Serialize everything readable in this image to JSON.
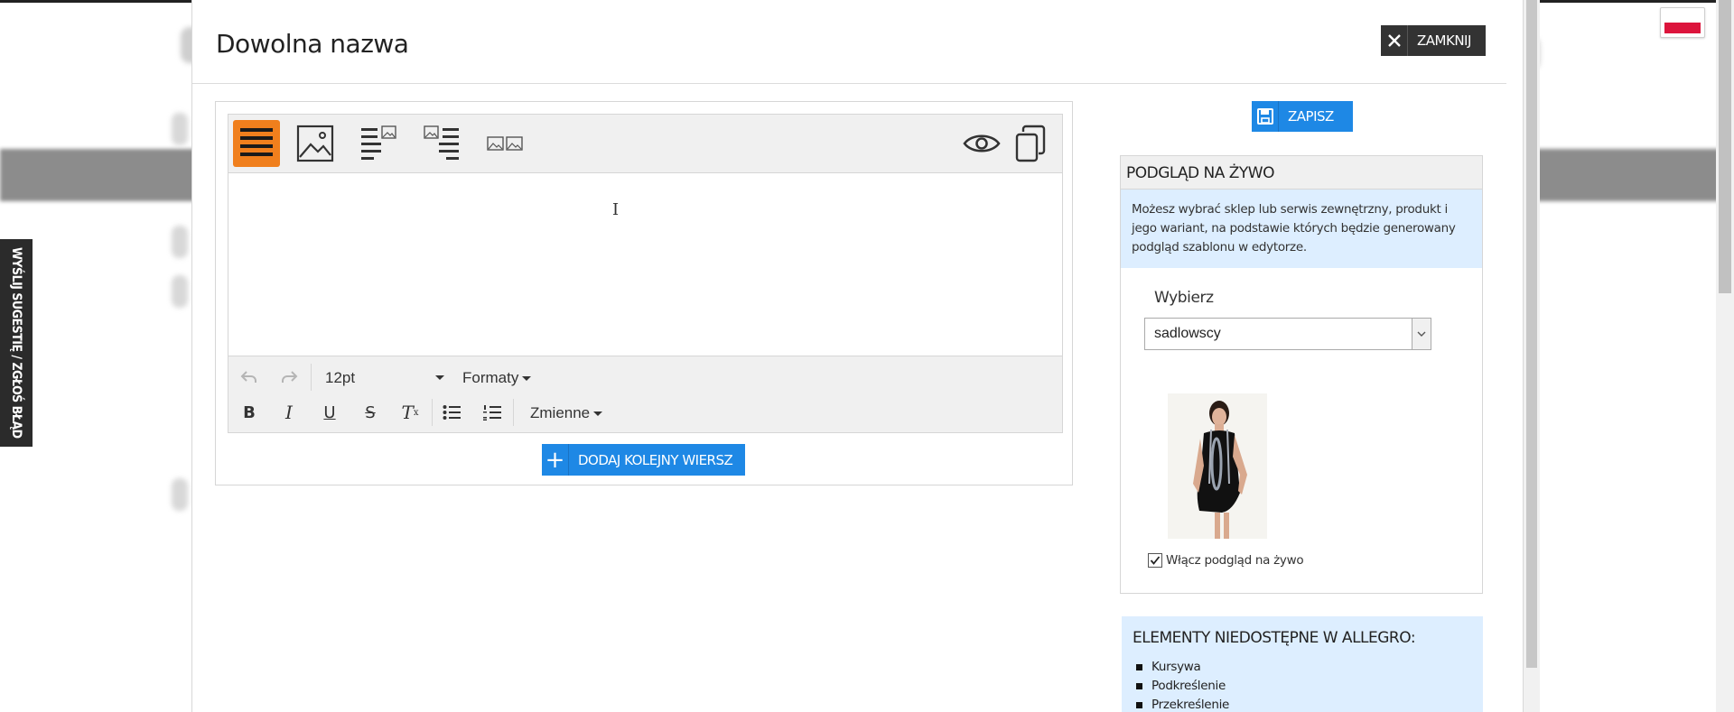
{
  "side_tab": {
    "label": "WYŚLIJ SUGESTIĘ / ZGŁOŚ BŁĄD"
  },
  "language": {
    "flag": "pl-flag",
    "colors": [
      "#ffffff",
      "#dc143c"
    ]
  },
  "modal": {
    "title": "Dowolna nazwa",
    "close_label": "ZAMKNIJ"
  },
  "editor": {
    "layout_tools": [
      {
        "name": "text-only-layout",
        "active": true
      },
      {
        "name": "image-only-layout",
        "active": false
      },
      {
        "name": "text-left-image-right-layout",
        "active": false
      },
      {
        "name": "image-left-text-right-layout",
        "active": false
      },
      {
        "name": "two-images-layout",
        "active": false
      }
    ],
    "preview_icon": "eye-icon",
    "copy_icon": "copy-icon",
    "font_size": "12pt",
    "formats_label": "Formaty",
    "variables_label": "Zmienne",
    "add_row_label": "DODAJ KOLEJNY WIERSZ",
    "accent_color": "#f07f1d"
  },
  "sidebar": {
    "save_label": "ZAPISZ",
    "preview_title": "PODGLĄD NA ŻYWO",
    "preview_info": "Możesz wybrać sklep lub serwis zewnętrzny, produkt i jego wariant, na podstawie których będzie generowany podgląd szablonu w edytorze.",
    "select_label": "Wybierz",
    "select_value": "sadlowscy",
    "live_preview_label": "Włącz podgląd na żywo",
    "live_preview_checked": true,
    "unavailable_title": "ELEMENTY NIEDOSTĘPNE W ALLEGRO:",
    "unavailable_items": [
      "Kursywa",
      "Podkreślenie",
      "Przekreślenie"
    ],
    "button_color": "#1e88e5",
    "info_bg": "#ddeeff"
  }
}
